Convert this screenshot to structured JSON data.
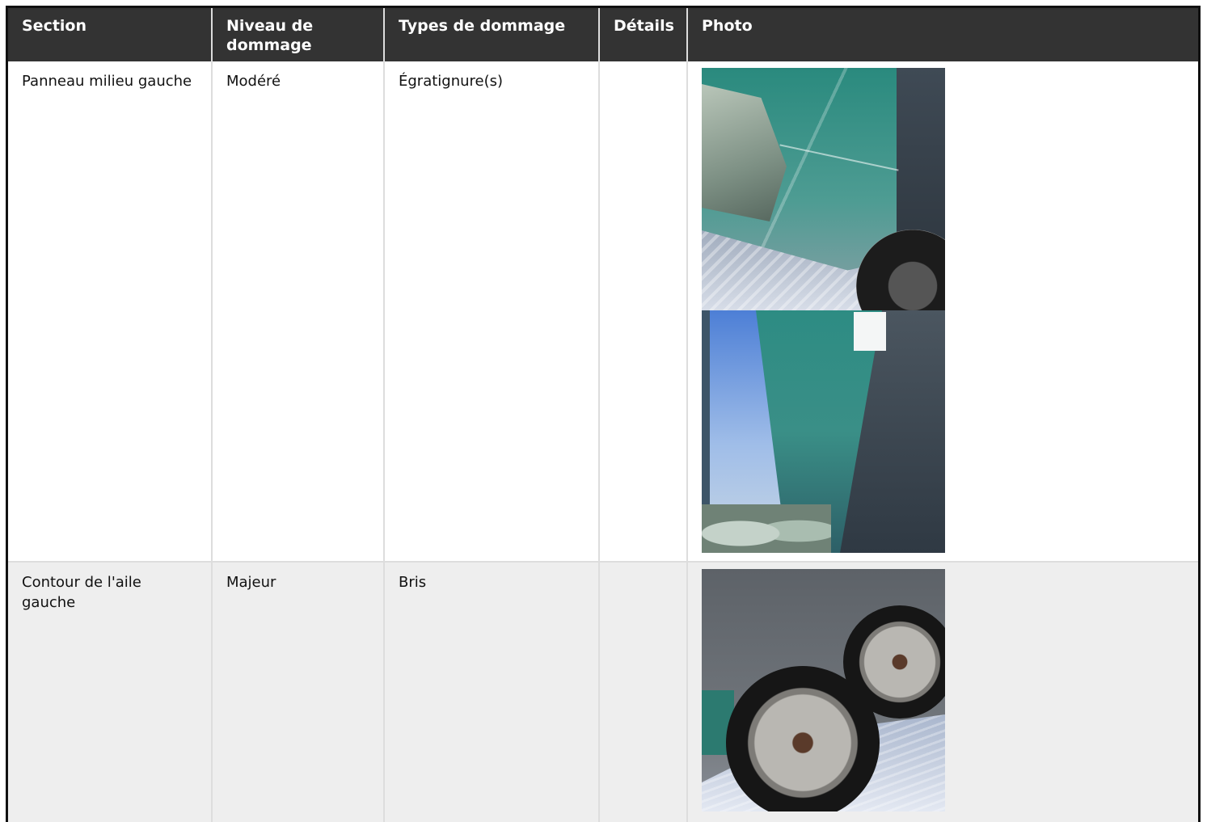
{
  "table": {
    "headers": [
      "Section",
      "Niveau de dommage",
      "Types de dommage",
      "Détails",
      "Photo"
    ],
    "rows": [
      {
        "section": "Panneau milieu gauche",
        "niveau": "Modéré",
        "types": "Égratignure(s)",
        "details": "",
        "photos": [
          "scratched-glass-panel-photo",
          "glass-panel-reflection-photo"
        ]
      },
      {
        "section": "Contour de l'aile gauche",
        "niveau": "Majeur",
        "types": "Bris",
        "details": "",
        "photos": [
          "trailer-wheels-photo"
        ]
      }
    ]
  }
}
